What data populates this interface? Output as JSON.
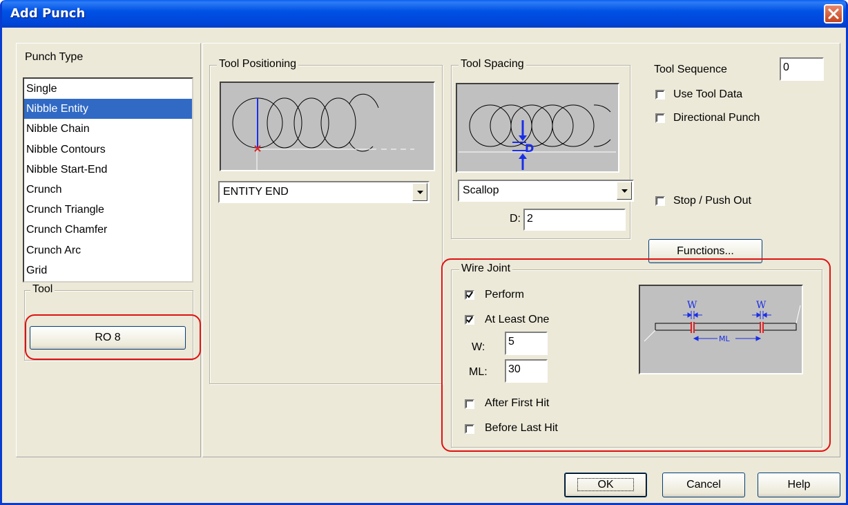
{
  "window": {
    "title": "Add Punch"
  },
  "punch_type": {
    "label": "Punch Type",
    "items": [
      "Single",
      "Nibble Entity",
      "Nibble Chain",
      "Nibble Contours",
      "Nibble Start-End",
      "Crunch",
      "Crunch Triangle",
      "Crunch Chamfer",
      "Crunch Arc",
      "Grid"
    ],
    "selected": "Nibble Entity"
  },
  "tool": {
    "label": "Tool",
    "button": "RO 8"
  },
  "tool_positioning": {
    "label": "Tool Positioning",
    "mode": "ENTITY END"
  },
  "tool_spacing": {
    "label": "Tool Spacing",
    "mode": "Scallop",
    "d_label": "D:",
    "d_value": "2",
    "diagram_letter": "D"
  },
  "tool_sequence": {
    "label": "Tool Sequence",
    "value": "0"
  },
  "options": {
    "use_tool_data": {
      "label": "Use Tool Data",
      "checked": false
    },
    "directional_punch": {
      "label": "Directional Punch",
      "checked": false
    },
    "stop_push_out": {
      "label": "Stop / Push Out",
      "checked": false
    }
  },
  "functions_button": "Functions...",
  "wire_joint": {
    "label": "Wire Joint",
    "perform": {
      "label": "Perform",
      "checked": true
    },
    "at_least_one": {
      "label": "At Least One",
      "checked": true
    },
    "w_label": "W:",
    "w_value": "5",
    "ml_label": "ML:",
    "ml_value": "30",
    "after_first_hit": {
      "label": "After First Hit",
      "checked": false
    },
    "before_last_hit": {
      "label": "Before Last Hit",
      "checked": false
    },
    "diagram": {
      "w_left": "W",
      "w_right": "W",
      "ml": "ML"
    }
  },
  "buttons": {
    "ok": "OK",
    "cancel": "Cancel",
    "help": "Help"
  },
  "colors": {
    "title_bar": "#0054e3",
    "selection": "#316ac5",
    "highlight_ring": "#e01010",
    "diagram_blue": "#1a2ee8",
    "diagram_red": "#e02020"
  }
}
